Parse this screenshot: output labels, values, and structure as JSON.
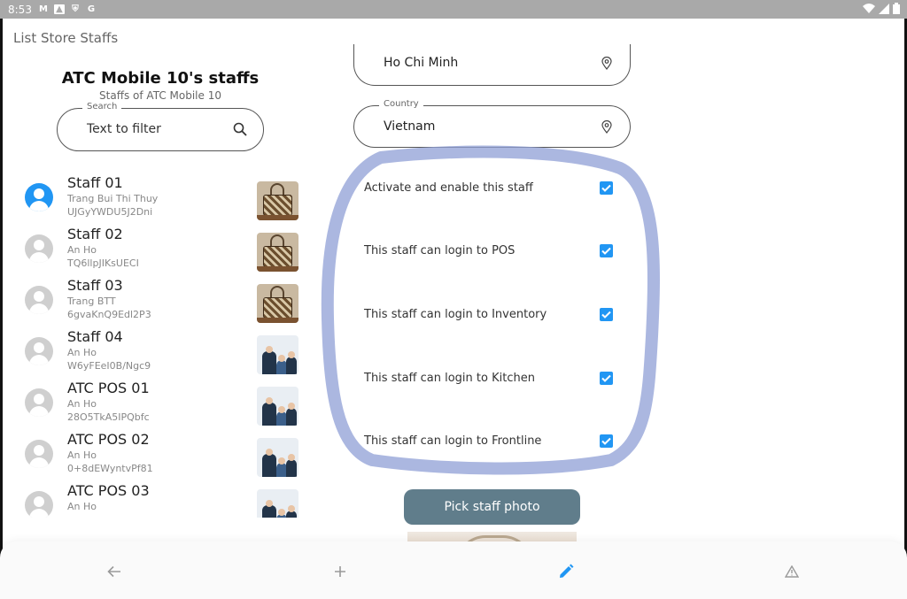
{
  "status_bar": {
    "time": "8:53",
    "icons_left": [
      "gmail-icon",
      "image-icon",
      "shield-icon",
      "google-icon"
    ],
    "icons_right": [
      "wifi-icon",
      "signal-icon",
      "battery-icon"
    ]
  },
  "app_bar": {
    "title": "List Store Staffs"
  },
  "left_panel": {
    "title": "ATC Mobile 10's staffs",
    "subtitle": "Staffs of ATC Mobile 10",
    "search": {
      "legend": "Search",
      "placeholder": "Text to filter"
    },
    "staff": [
      {
        "name": "Staff 01",
        "full_name": "Trang Bui Thi Thuy",
        "code": "UJGyYWDU5J2Dni",
        "active": true,
        "photo": "bag"
      },
      {
        "name": "Staff 02",
        "full_name": "An Ho",
        "code": "TQ6llpJIKsUECI",
        "active": false,
        "photo": "bag"
      },
      {
        "name": "Staff 03",
        "full_name": "Trang BTT",
        "code": "6gvaKnQ9Edl2P3",
        "active": false,
        "photo": "bag"
      },
      {
        "name": "Staff 04",
        "full_name": "An Ho",
        "code": "W6yFEeI0B/Ngc9",
        "active": false,
        "photo": "family"
      },
      {
        "name": "ATC POS 01",
        "full_name": "An Ho",
        "code": "28O5TkA5IPQbfc",
        "active": false,
        "photo": "family"
      },
      {
        "name": "ATC POS 02",
        "full_name": "An Ho",
        "code": "0+8dEWyntvPf81",
        "active": false,
        "photo": "family"
      },
      {
        "name": "ATC POS 03",
        "full_name": "An Ho",
        "code": "",
        "active": false,
        "photo": "family"
      }
    ]
  },
  "form": {
    "city": {
      "value": "Ho Chi Minh"
    },
    "country": {
      "legend": "Country",
      "value": "Vietnam"
    },
    "permissions": [
      {
        "label": "Activate and enable this staff",
        "checked": true
      },
      {
        "label": "This staff can login to POS",
        "checked": true
      },
      {
        "label": "This staff can login to Inventory",
        "checked": true
      },
      {
        "label": "This staff can login to Kitchen",
        "checked": true
      },
      {
        "label": "This staff can login to Frontline",
        "checked": true
      }
    ],
    "pick_photo_label": "Pick staff photo"
  },
  "bottom_nav": [
    "arrow-left-icon",
    "plus-icon",
    "pencil-icon",
    "warning-icon"
  ],
  "colors": {
    "accent": "#2196f3",
    "button": "#607d8b",
    "annotation": "#8f9fd6",
    "status_bar": "#a9a9a9"
  }
}
